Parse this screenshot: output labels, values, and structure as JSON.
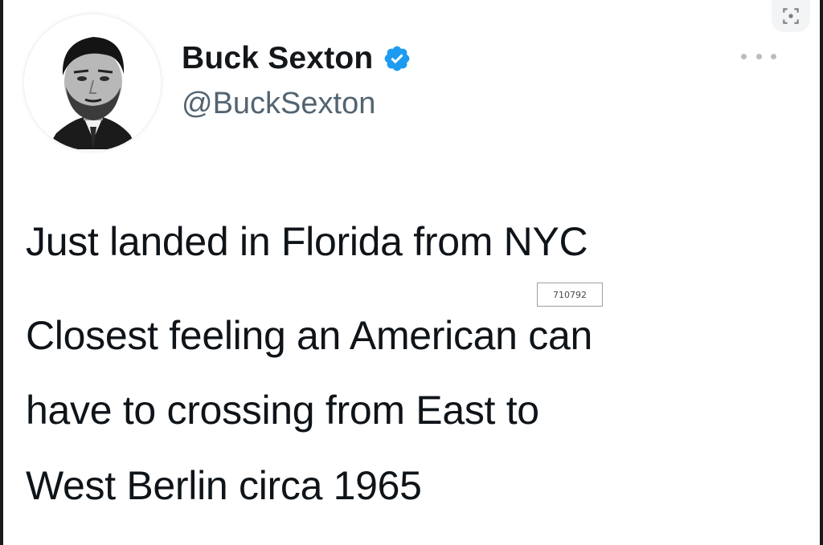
{
  "tweet": {
    "author": {
      "display_name": "Buck Sexton",
      "handle": "@BuckSexton",
      "verified": true,
      "verified_color": "#1d9bf0"
    },
    "text_lines": [
      "Just landed in Florida from NYC",
      "Closest feeling an American can",
      "have to crossing from East to",
      "West Berlin circa 1965"
    ],
    "menu_icon": "more-horizontal-icon"
  },
  "overlay": {
    "stamp_text": "710792",
    "lens_icon": "visual-search-icon"
  },
  "colors": {
    "text_primary": "#0f1419",
    "text_secondary": "#536471",
    "background": "#ffffff"
  }
}
